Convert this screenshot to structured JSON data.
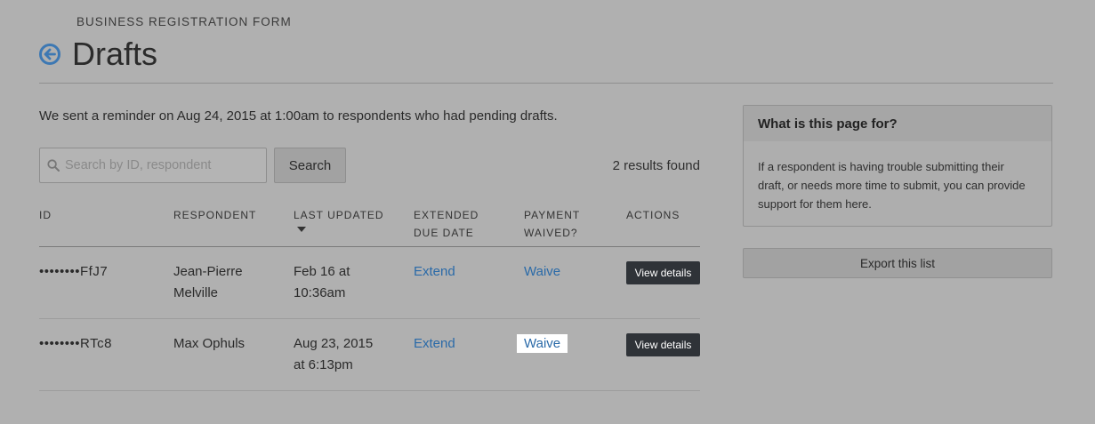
{
  "header": {
    "eyebrow": "BUSINESS REGISTRATION FORM",
    "title": "Drafts",
    "back_icon": "arrow-circle-left-icon"
  },
  "reminder_text": "We sent a reminder on Aug 24, 2015 at 1:00am to respondents who had pending drafts.",
  "search": {
    "placeholder": "Search by ID, respondent",
    "value": "",
    "button_label": "Search"
  },
  "results_count": "2 results found",
  "table": {
    "columns": {
      "id": "ID",
      "respondent": "RESPONDENT",
      "last_updated": "LAST UPDATED",
      "extended_line1": "EXTENDED",
      "extended_line2": "DUE DATE",
      "payment_line1": "PAYMENT",
      "payment_line2": "WAIVED?",
      "actions": "ACTIONS"
    },
    "rows": [
      {
        "id": "••••••••FfJ7",
        "respondent_line1": "Jean-Pierre",
        "respondent_line2": "Melville",
        "updated_line1": "Feb 16 at",
        "updated_line2": "10:36am",
        "extend": "Extend",
        "waive": "Waive",
        "action": "View details"
      },
      {
        "id": "••••••••RTc8",
        "respondent_line1": "Max Ophuls",
        "respondent_line2": "",
        "updated_line1": "Aug 23, 2015",
        "updated_line2": "at 6:13pm",
        "extend": "Extend",
        "waive": "Waive",
        "action": "View details"
      }
    ]
  },
  "sidebar": {
    "panel_title": "What is this page for?",
    "panel_line1": "If a respondent is having trouble submitting their",
    "panel_line2": "draft, or needs more time to submit, you can provide",
    "panel_line3": "support for them here.",
    "export_label": "Export this list"
  },
  "colors": {
    "background": "#b0b0b0",
    "link": "#2a6aa8",
    "button_dark": "#2f3338",
    "highlight": "#ffffff"
  }
}
